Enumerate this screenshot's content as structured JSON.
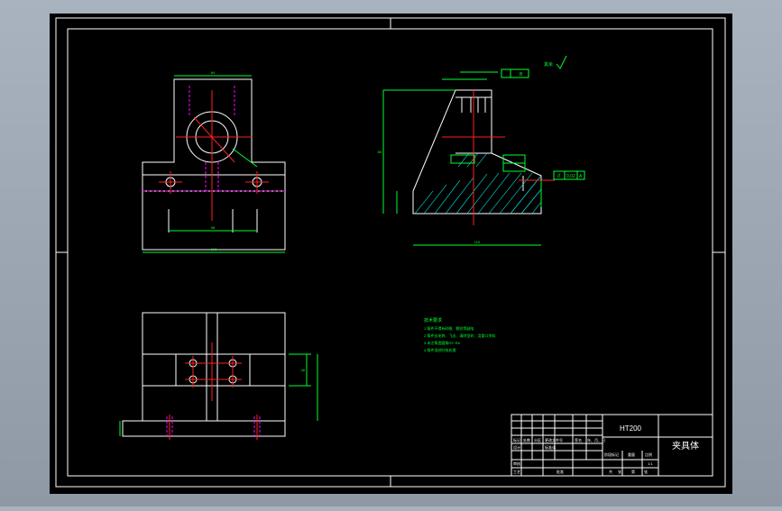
{
  "drawing": {
    "title_block": {
      "material": "HT200",
      "part_name": "夹具体",
      "scale": "1:1",
      "cells": [
        "标记",
        "处数",
        "分区",
        "更改文件号",
        "签名",
        "年、月、日",
        "设计",
        "标准化",
        "审核",
        "工艺",
        "批准",
        "阶段标记",
        "重量",
        "比例",
        "共",
        "张",
        "第",
        "张"
      ]
    },
    "tech_notes": {
      "heading": "技术要求",
      "lines": [
        "1.铸件不得有砂眼、裂纹等缺陷",
        "2.铸件去毛刺、飞边、清除型砂、浇冒口余料",
        "3.未注铸造圆角R3~R5",
        "4.铸件须经时效处理"
      ]
    },
    "roughness_note": "其余",
    "dimensions": {
      "front_top_width": "84",
      "front_base_width": "136",
      "front_hole_spacing": "98",
      "side_base_length": "110",
      "side_height": "85",
      "top_view_spacing": "48"
    },
    "geometric_tolerance": {
      "symbol_parallel": "//",
      "value": "0.02",
      "datum": "A",
      "datum_b": "B"
    },
    "colors": {
      "outline": "#ffffff",
      "centerline": "#ff2020",
      "dimension": "#00ff30",
      "hidden": "#ff00ff",
      "hatch": "#00ffff",
      "background": "#000000"
    }
  }
}
